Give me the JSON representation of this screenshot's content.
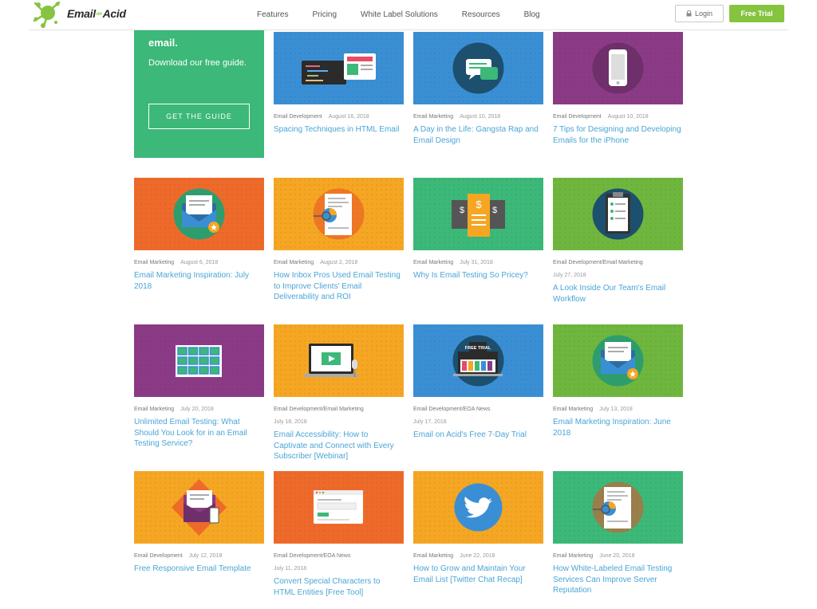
{
  "header": {
    "logo": {
      "part1": "Email",
      "part2": "on",
      "part3": "Acid"
    },
    "nav": [
      "Features",
      "Pricing",
      "White Label Solutions",
      "Resources",
      "Blog"
    ],
    "login_label": "Login",
    "trial_label": "Free Trial",
    "colors": {
      "accent": "#86c440",
      "logo_splash": "#86c440"
    }
  },
  "promo": {
    "heading": "email.",
    "subtitle": "Download our free guide.",
    "button_label": "GET THE GUIDE",
    "color": "#3cb878"
  },
  "posts": [
    {
      "category": "Email Development",
      "date": "August 16, 2018",
      "title": "Spacing Techniques in HTML Email",
      "color": "#3a8fd4",
      "icon": "code-editor-icon"
    },
    {
      "category": "Email Marketing",
      "date": "August 10, 2018",
      "title": "A Day in the Life: Gangsta Rap and Email Design",
      "color": "#3a8fd4",
      "icon": "chat-bubbles-icon"
    },
    {
      "category": "Email Development",
      "date": "August 10, 2018",
      "title": "7 Tips for Designing and Developing Emails for the iPhone",
      "color": "#8b3b86",
      "icon": "iphone-icon"
    },
    {
      "category": "Email Marketing",
      "date": "August 6, 2018",
      "title": "Email Marketing Inspiration: July 2018",
      "color": "#ee6a2a",
      "icon": "envelope-icon"
    },
    {
      "category": "Email Marketing",
      "date": "August 2, 2018",
      "title": "How Inbox Pros Used Email Testing to Improve Clients' Email Deliverability and ROI",
      "color": "#f5a623",
      "icon": "report-chart-icon"
    },
    {
      "category": "Email Marketing",
      "date": "July 31, 2018",
      "title": "Why Is Email Testing So Pricey?",
      "color": "#3cb878",
      "icon": "price-cards-icon"
    },
    {
      "category": "Email Development/Email Marketing",
      "date": "July 27, 2018",
      "title": "A Look Inside Our Team's Email Workflow",
      "color": "#6fb63e",
      "icon": "clipboard-icon"
    },
    {
      "category": "Email Marketing",
      "date": "July 20, 2018",
      "title": "Unlimited Email Testing: What Should You Look for in an Email Testing Service?",
      "color": "#8b3b86",
      "icon": "grid-screens-icon"
    },
    {
      "category": "Email Development/Email Marketing",
      "date": "July 18, 2018",
      "title": "Email Accessibility: How to Captivate and Connect with Every Subscriber [Webinar]",
      "color": "#f5a623",
      "icon": "video-laptop-icon"
    },
    {
      "category": "Email Development/EOA News",
      "date": "July 17, 2018",
      "title": "Email on Acid's Free 7-Day Trial",
      "color": "#3a8fd4",
      "icon": "free-trial-laptop-icon",
      "badge": "FREE TRIAL"
    },
    {
      "category": "Email Marketing",
      "date": "July 13, 2018",
      "title": "Email Marketing Inspiration: June 2018",
      "color": "#6fb63e",
      "icon": "envelope-icon"
    },
    {
      "category": "Email Development",
      "date": "July 12, 2018",
      "title": "Free Responsive Email Template",
      "color": "#f5a623",
      "icon": "open-envelope-phone-icon"
    },
    {
      "category": "Email Development/EOA News",
      "date": "July 11, 2018",
      "title": "Convert Special Characters to HTML Entities [Free Tool]",
      "color": "#ee6a2a",
      "icon": "browser-window-icon"
    },
    {
      "category": "Email Marketing",
      "date": "June 22, 2018",
      "title": "How to Grow and Maintain Your Email List [Twitter Chat Recap]",
      "color": "#f5a623",
      "icon": "twitter-bird-icon"
    },
    {
      "category": "Email Marketing",
      "date": "June 20, 2018",
      "title": "How White-Labeled Email Testing Services Can Improve Server Reputation",
      "color": "#3cb878",
      "icon": "report-chart-icon"
    }
  ]
}
